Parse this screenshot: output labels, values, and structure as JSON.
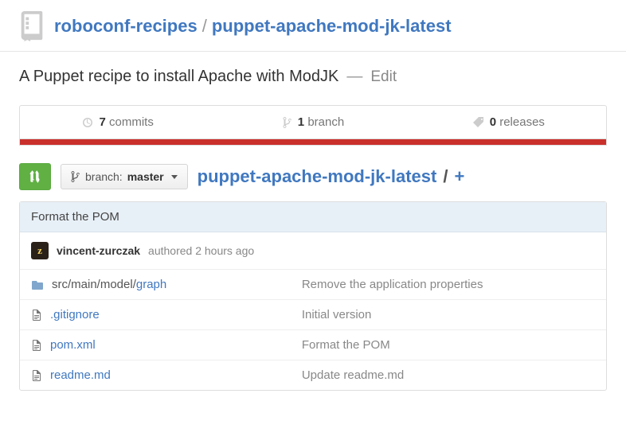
{
  "breadcrumb": {
    "owner": "roboconf-recipes",
    "sep": "/",
    "repo": "puppet-apache-mod-jk-latest"
  },
  "description": {
    "text": "A Puppet recipe to install Apache with ModJK",
    "dash": "—",
    "edit": "Edit"
  },
  "stats": {
    "commits": {
      "num": "7",
      "label": "commits"
    },
    "branches": {
      "num": "1",
      "label": "branch"
    },
    "releases": {
      "num": "0",
      "label": "releases"
    }
  },
  "branch": {
    "prefix": "branch:",
    "name": "master"
  },
  "path": {
    "root": "puppet-apache-mod-jk-latest",
    "sep": "/",
    "plus": "+"
  },
  "commit": {
    "title": "Format the POM",
    "avatar_letter": "z",
    "author": "vincent-zurczak",
    "meta": "authored 2 hours ago"
  },
  "files": [
    {
      "type": "folder",
      "path_prefix": "src/main/model/",
      "link": "graph",
      "msg": "Remove the application properties"
    },
    {
      "type": "file",
      "link": ".gitignore",
      "msg": "Initial version"
    },
    {
      "type": "file",
      "link": "pom.xml",
      "msg": "Format the POM"
    },
    {
      "type": "file",
      "link": "readme.md",
      "msg": "Update readme.md"
    }
  ]
}
